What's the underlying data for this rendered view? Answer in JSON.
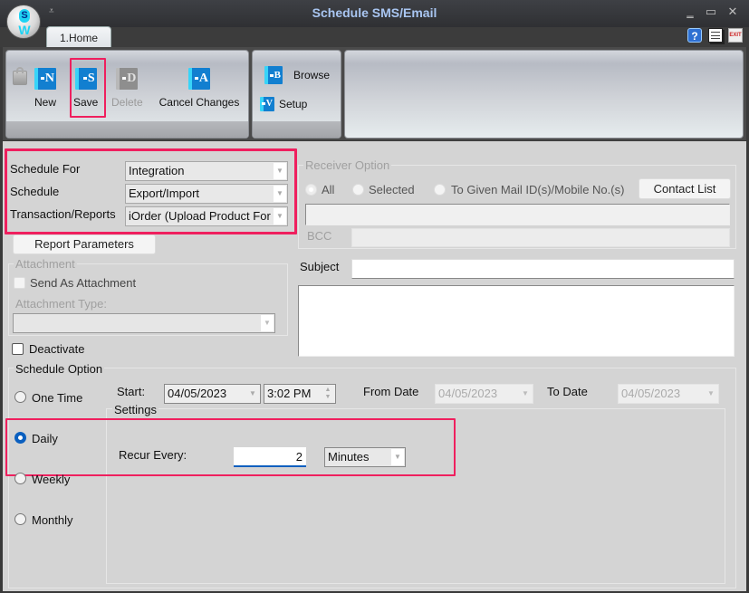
{
  "window": {
    "title": "Schedule SMS/Email",
    "logo_letters": {
      "top": "S",
      "bottom": "W"
    },
    "quick_access_icon": "chevron-down-icon",
    "controls": {
      "minimize": "‗",
      "maximize": "▭",
      "close": "✕"
    }
  },
  "tabs": [
    {
      "label": "1.Home",
      "active": true
    }
  ],
  "top_right_icons": [
    "help-icon",
    "document-icon",
    "exit-icon"
  ],
  "exit_label": "EXIT",
  "ribbon": {
    "group1": [
      {
        "name": "lock",
        "label": "",
        "icon": "lock-icon",
        "enabled": false
      },
      {
        "name": "new",
        "label": "New",
        "letter": "N",
        "enabled": true
      },
      {
        "name": "save",
        "label": "Save",
        "letter": "S",
        "enabled": true,
        "highlighted": true
      },
      {
        "name": "delete",
        "label": "Delete",
        "letter": "D",
        "enabled": false
      },
      {
        "name": "cancel",
        "label": "Cancel Changes",
        "letter": "A",
        "enabled": true
      }
    ],
    "group2": [
      {
        "name": "browse",
        "label": "Browse",
        "letter": "B"
      },
      {
        "name": "setup",
        "label": "Setup",
        "letter": "V"
      }
    ]
  },
  "form": {
    "schedule_for": {
      "label": "Schedule For",
      "value": "Integration"
    },
    "schedule": {
      "label": "Schedule",
      "value": "Export/Import"
    },
    "transaction_reports": {
      "label": "Transaction/Reports",
      "value": "iOrder (Upload Product For"
    },
    "report_parameters_button": "Report Parameters",
    "attachment": {
      "legend": "Attachment",
      "send_as_attachment": {
        "label": "Send As Attachment",
        "checked": false
      },
      "attachment_type_label": "Attachment Type:",
      "attachment_type_value": ""
    },
    "deactivate": {
      "label": "Deactivate",
      "checked": false
    },
    "receiver": {
      "legend": "Receiver Option",
      "options": [
        "All",
        "Selected",
        "To Given Mail ID(s)/Mobile No.(s)"
      ],
      "selected": "All",
      "contact_list_button": "Contact List",
      "to_value": "",
      "bcc_label": "BCC",
      "bcc_value": ""
    },
    "subject": {
      "label": "Subject",
      "value": ""
    },
    "body": "",
    "schedule_option": {
      "legend": "Schedule Option",
      "frequencies": [
        "One Time",
        "Daily",
        "Weekly",
        "Monthly"
      ],
      "selected": "Daily",
      "start_label": "Start:",
      "start_date": "04/05/2023",
      "start_time": "3:02 PM",
      "from_date_label": "From Date",
      "from_date": "04/05/2023",
      "to_date_label": "To Date",
      "to_date": "04/05/2023",
      "settings_legend": "Settings",
      "recur_every_label": "Recur Every:",
      "recur_every_value": "2",
      "recur_unit": "Minutes"
    }
  },
  "colors": {
    "highlight": "#ef1f5e",
    "accent": "#0a5fbf",
    "title": "#a9c6f2"
  }
}
